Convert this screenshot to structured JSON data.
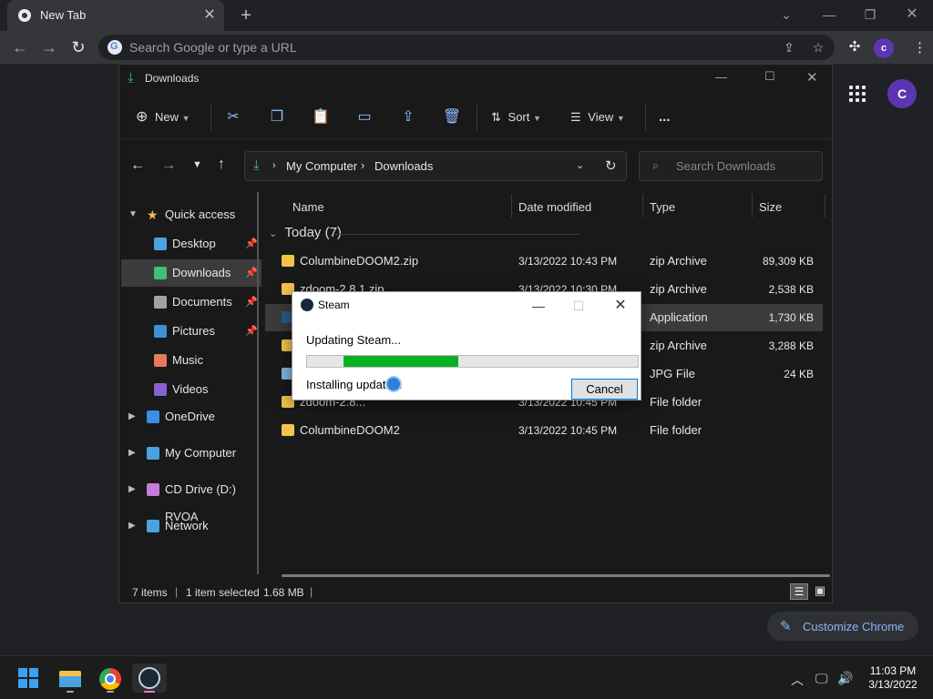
{
  "chrome": {
    "tab_title": "New Tab",
    "omnibox_placeholder": "Search Google or type a URL",
    "profile_initial": "C",
    "profile_initial_small": "c",
    "customize_label": "Customize Chrome",
    "accent": "#8ab4f8"
  },
  "explorer": {
    "title": "Downloads",
    "commands": {
      "new": "New",
      "sort": "Sort",
      "view": "View",
      "more": "..."
    },
    "breadcrumb": [
      "My Computer",
      "Downloads"
    ],
    "search_placeholder": "Search Downloads",
    "nav": {
      "quick_access": "Quick access",
      "quick_items": [
        {
          "label": "Desktop",
          "icon": "desktop-icon",
          "color": "#4aa3df"
        },
        {
          "label": "Downloads",
          "icon": "download-icon",
          "color": "#3fbf7f"
        },
        {
          "label": "Documents",
          "icon": "documents-icon",
          "color": "#9aa4ad"
        },
        {
          "label": "Pictures",
          "icon": "pictures-icon",
          "color": "#3d8fd6"
        },
        {
          "label": "Music",
          "icon": "music-icon",
          "color": "#e57a5a"
        },
        {
          "label": "Videos",
          "icon": "videos-icon",
          "color": "#8b5fd6"
        }
      ],
      "groups": [
        {
          "label": "OneDrive",
          "icon": "cloud-icon",
          "color": "#3a8ee6"
        },
        {
          "label": "My Computer",
          "icon": "computer-icon",
          "color": "#4aa3df"
        },
        {
          "label": "CD Drive (D:) RVOA",
          "icon": "cd-drive-icon",
          "color": "#c77dd6"
        },
        {
          "label": "Network",
          "icon": "network-icon",
          "color": "#4aa3df"
        }
      ]
    },
    "columns": [
      "Name",
      "Date modified",
      "Type",
      "Size"
    ],
    "group_header": "Today (7)",
    "files": [
      {
        "name": "ColumbineDOOM2.zip",
        "date": "3/13/2022 10:43 PM",
        "type": "zip Archive",
        "size": "89,309 KB",
        "icon": "zip-icon"
      },
      {
        "name": "zdoom-2.8.1.zip",
        "date": "3/13/2022 10:30 PM",
        "type": "zip Archive",
        "size": "2,538 KB",
        "icon": "zip-icon"
      },
      {
        "name": "",
        "date": "",
        "type": "Application",
        "size": "1,730 KB",
        "icon": "steam-setup-icon"
      },
      {
        "name": "",
        "date": "",
        "type": "zip Archive",
        "size": "3,288 KB",
        "icon": "zip-icon"
      },
      {
        "name": "",
        "date": "",
        "type": "JPG File",
        "size": "24 KB",
        "icon": "image-icon"
      },
      {
        "name": "zdoom-2.8...",
        "date": "3/13/2022 10:45 PM",
        "type": "File folder",
        "size": "",
        "icon": "folder-icon"
      },
      {
        "name": "ColumbineDOOM2",
        "date": "3/13/2022 10:45 PM",
        "type": "File folder",
        "size": "",
        "icon": "folder-icon"
      }
    ],
    "status": {
      "items": "7 items",
      "selected": "1 item selected",
      "size": "1.68 MB"
    }
  },
  "steam_dialog": {
    "title": "Steam",
    "message": "Updating Steam...",
    "progress": 0.345,
    "progress_color": "#06b025",
    "status": "Installing update...",
    "cancel": "Cancel"
  },
  "taskbar": {
    "time": "11:03 PM",
    "date": "3/13/2022"
  }
}
